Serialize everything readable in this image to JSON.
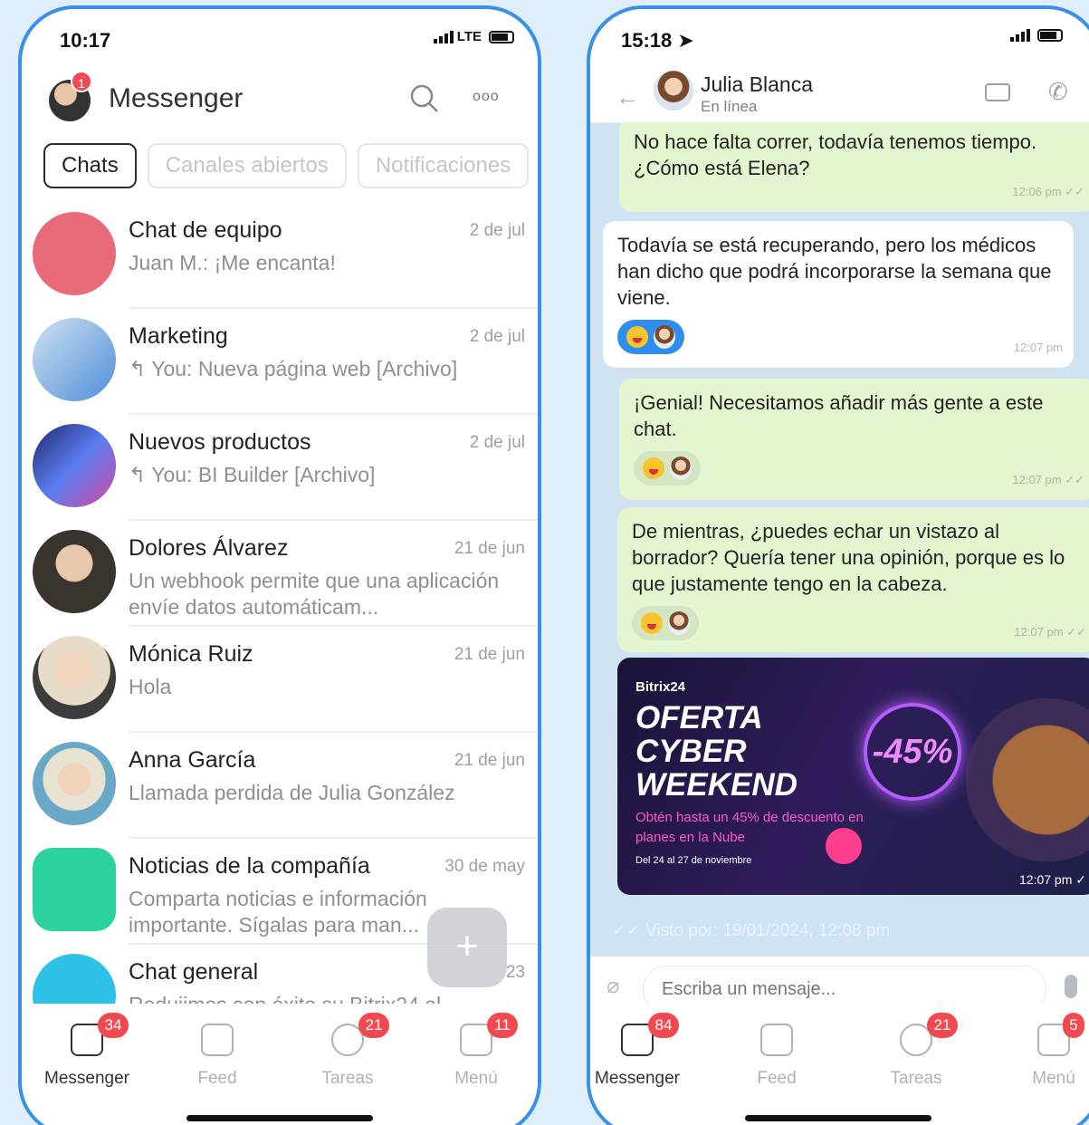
{
  "left": {
    "status": {
      "time": "10:17",
      "network": "LTE"
    },
    "header": {
      "badge": "1",
      "title": "Messenger"
    },
    "tabs": [
      {
        "label": "Chats"
      },
      {
        "label": "Canales abiertos"
      },
      {
        "label": "Notificaciones"
      }
    ],
    "chats": [
      {
        "name": "Chat de equipo",
        "date": "2 de jul",
        "message": "Juan M.: ¡Me encanta!",
        "avatar_color": "#e96a78"
      },
      {
        "name": "Marketing",
        "date": "2 de jul",
        "message": "↰ You: Nueva página web [Archivo]",
        "avatar_color": "#4f8fd6",
        "ticks": "double"
      },
      {
        "name": "Nuevos productos",
        "date": "2 de jul",
        "message": "↰ You: BI Builder [Archivo]",
        "avatar_color": "#3b56c9",
        "ticks": "double"
      },
      {
        "name": "Dolores Álvarez",
        "date": "21 de jun",
        "message": "Un webhook permite que una aplicación envíe datos automáticam...",
        "avatar_color": "#4a5560",
        "ticks": "single"
      },
      {
        "name": "Mónica Ruiz",
        "date": "21 de jun",
        "message": "Hola",
        "avatar_color": "#9aa6ae",
        "ticks": "single"
      },
      {
        "name": "Anna García",
        "date": "21 de jun",
        "message": "Llamada perdida de Julia González",
        "avatar_color": "#5f9fbf",
        "ticks": "single"
      },
      {
        "name": "Noticias de la compañía",
        "date": "30 de may",
        "message": "Comparta noticias e información importante. Sígalas para man...",
        "avatar_color": "#2bd2a0"
      },
      {
        "name": "Chat general",
        "date": "23",
        "message": "Redujimos con éxito su Bitrix24 al",
        "avatar_color": "#2ec1e6"
      }
    ],
    "fab": "+",
    "tabbar": [
      {
        "label": "Messenger",
        "badge": "34"
      },
      {
        "label": "Feed",
        "badge": ""
      },
      {
        "label": "Tareas",
        "badge": "21"
      },
      {
        "label": "Menú",
        "badge": "11"
      }
    ]
  },
  "right": {
    "status": {
      "time": "15:18 ➤"
    },
    "header": {
      "name": "Julia Blanca",
      "status": "En línea"
    },
    "messages": [
      {
        "text": "No hace falta correr, todavía tenemos tiempo. ¿Cómo está Elena?",
        "time": "12:06 pm ✓✓"
      },
      {
        "text": "Todavía se está recuperando, pero los médicos han dicho que podrá incorporarse la semana que viene.",
        "time": "12:07 pm"
      },
      {
        "text": "¡Genial! Necesitamos añadir más gente a este chat.",
        "time": "12:07 pm ✓✓"
      },
      {
        "text": "De mientras, ¿puedes echar un vistazo al borrador? Quería tener una opinión, porque es lo que justamente tengo en la cabeza.",
        "time": "12:07 pm ✓✓"
      }
    ],
    "promo": {
      "brand": "Bitrix24",
      "headline": "OFERTA CYBER WEEKEND",
      "sub": "Obtén hasta un 45% de descuento en planes en la Nube",
      "dates": "Del 24 al 27 de noviembre",
      "discount": "-45%",
      "time": "12:07 pm ✓"
    },
    "seen": "✓✓ Visto por: 19/01/2024, 12:08 pm",
    "compose": {
      "placeholder": "Escriba un mensaje..."
    },
    "tabbar": [
      {
        "label": "Messenger",
        "badge": "84"
      },
      {
        "label": "Feed",
        "badge": ""
      },
      {
        "label": "Tareas",
        "badge": "21"
      },
      {
        "label": "Menú",
        "badge": "5"
      }
    ]
  }
}
